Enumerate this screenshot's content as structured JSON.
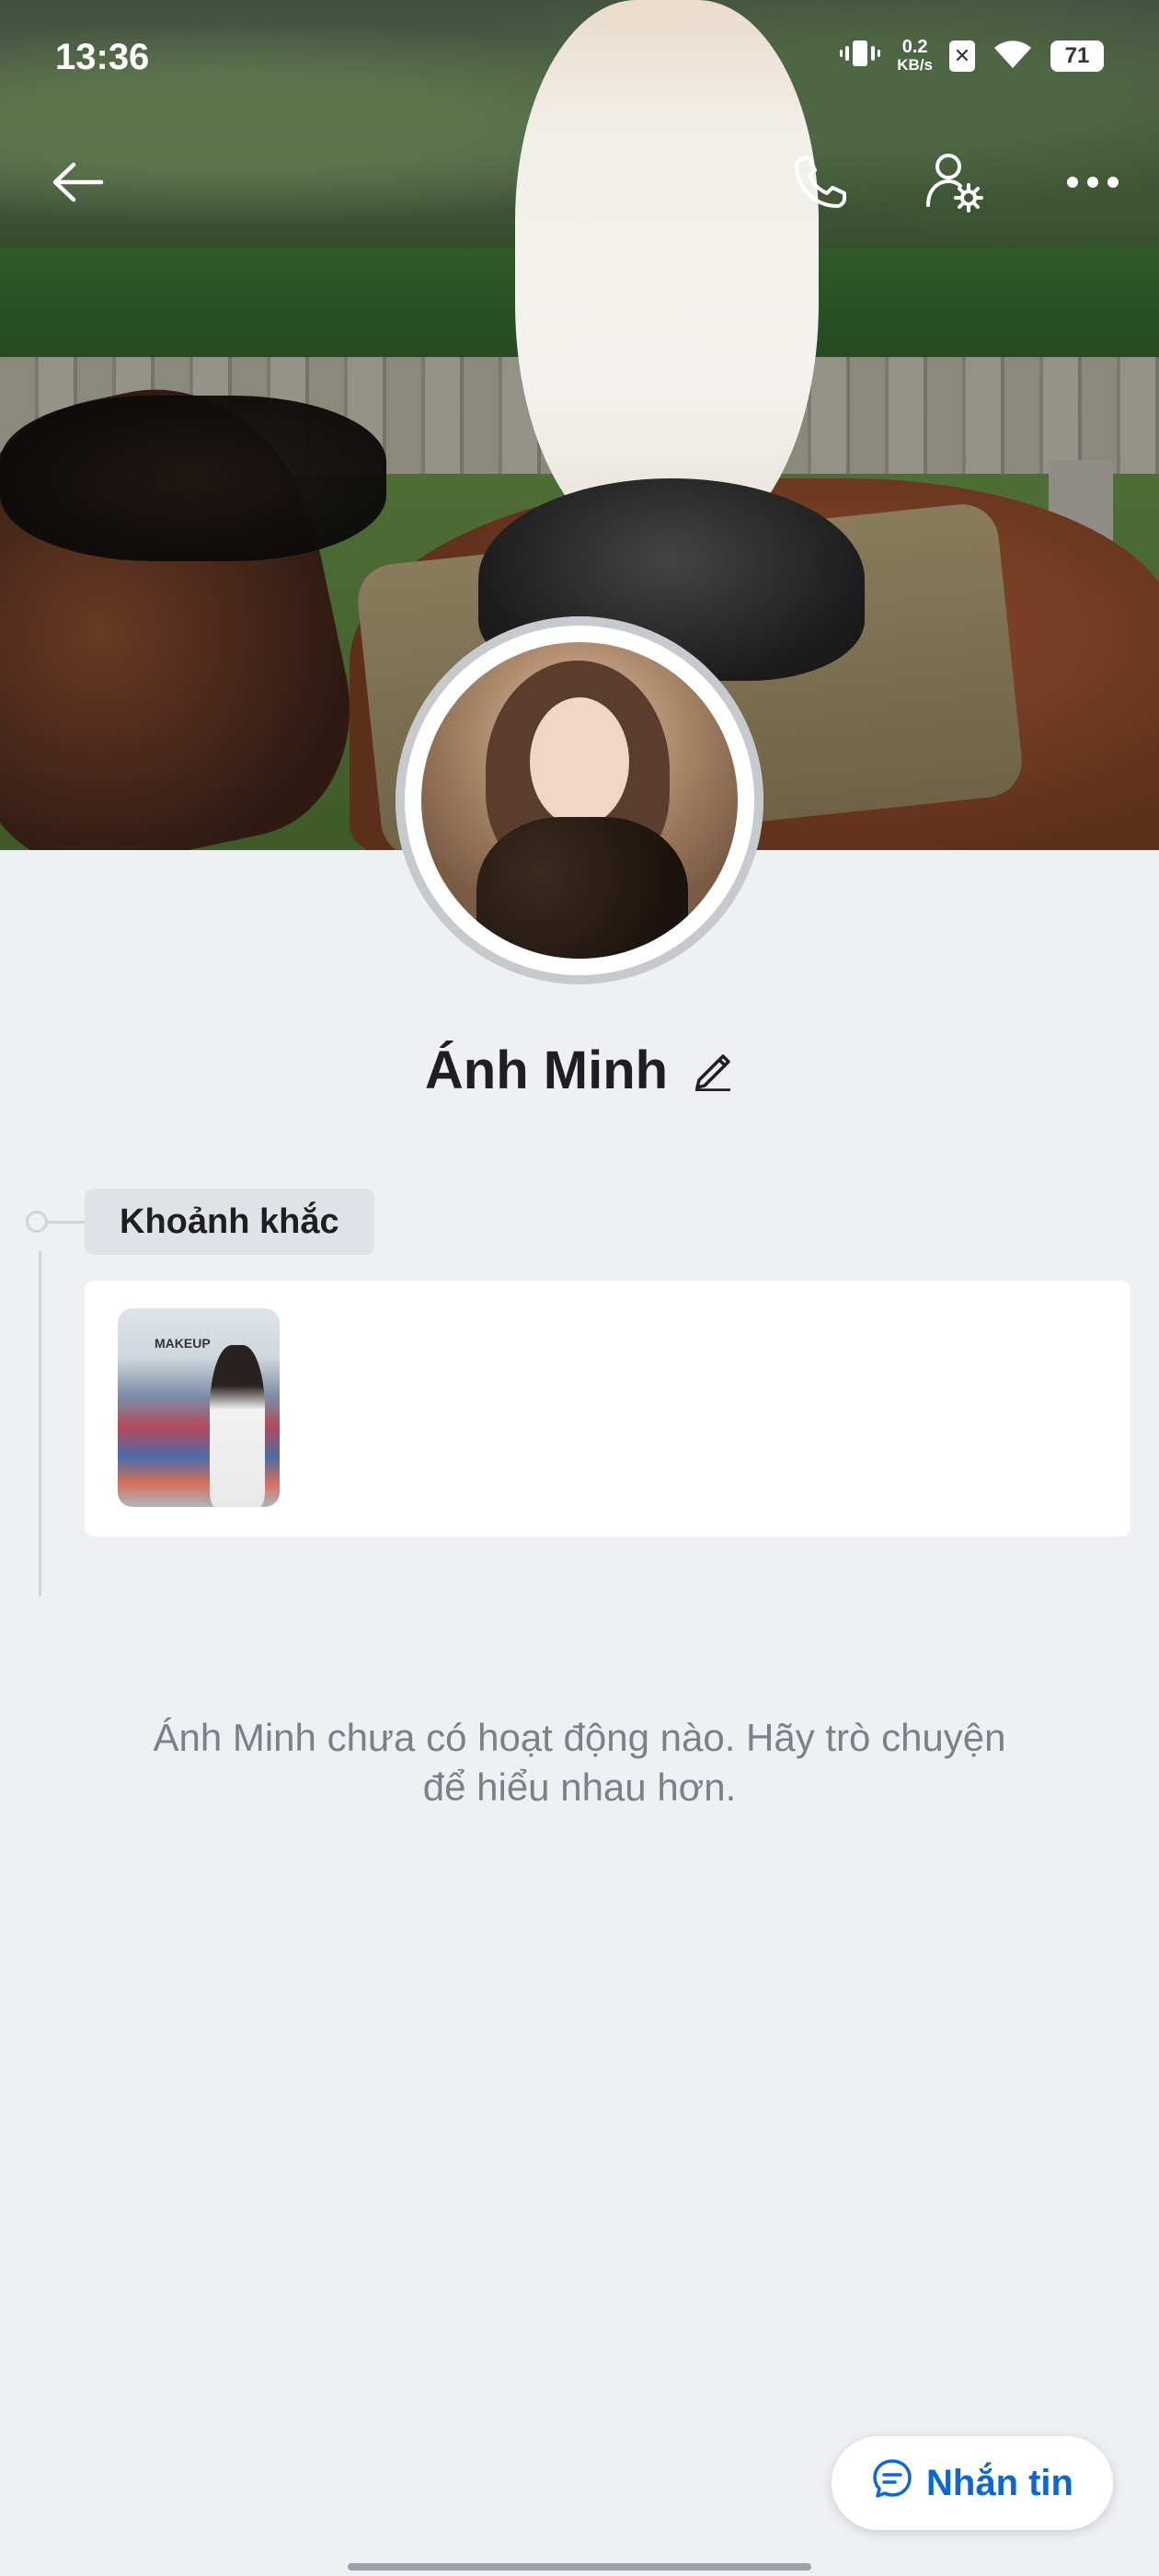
{
  "status_bar": {
    "time": "13:36",
    "net_speed_value": "0.2",
    "net_speed_unit": "KB/s",
    "battery": "71"
  },
  "header": {
    "icons": [
      "arrow-left-icon",
      "phone-icon",
      "user-settings-icon",
      "more-icon"
    ]
  },
  "profile": {
    "name": "Ánh Minh"
  },
  "moments": {
    "label": "Khoảnh khắc",
    "thumbnail_sign": "MAKEUP"
  },
  "empty_state": {
    "line1": "Ánh Minh chưa có hoạt động nào. Hãy trò chuyện",
    "line2": "để hiểu nhau hơn."
  },
  "message_button": {
    "label": "Nhắn tin"
  },
  "colors": {
    "accent": "#0a68d6",
    "background": "#eef0f4"
  }
}
